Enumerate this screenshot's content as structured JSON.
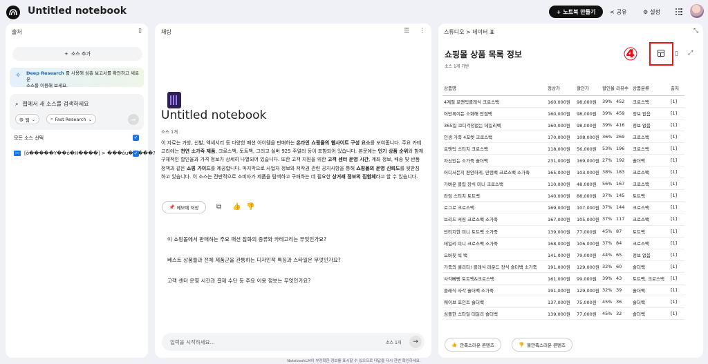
{
  "app": {
    "title": "Untitled notebook",
    "new_notebook": "노트북 만들기",
    "share": "공유",
    "settings": "설정"
  },
  "sources": {
    "title": "출처",
    "add_source": "소스 추가",
    "deep_research_strong": "Deep Research",
    "deep_research_text_1": "를 사용해 심층 보고서를 확인하고 새로운",
    "deep_research_text_2": "소스를 이용해 보세요.",
    "search_placeholder": "웹에서 새 소스를 검색하세요",
    "chip_web": "웹",
    "chip_research": "Fast Research",
    "select_all": "모든 소스 선택",
    "items": [
      {
        "name": "[ǒ�����Y��ǒ�H����] > ���ǒu�����?"
      }
    ]
  },
  "chat": {
    "title": "채팅",
    "notebook_title": "Untitled notebook",
    "source_count": "소스 1개",
    "save_memo": "메모에 저장",
    "questions": [
      "이 쇼핑몰에서 판매하는 주요 패션 잡화의 종류와 카테고리는 무엇인가요?",
      "베스트 상품들과 전체 제품군을 관통하는 디자인적 특징과 스타일은 무엇인가요?",
      "고객 센터 운영 시간과 결제 수단 등 주요 이용 정보는 무엇인가요?"
    ],
    "input_placeholder": "입력을 시작하세요...",
    "input_count": "소스 1개",
    "footer": "NotebookLM이 부정확한 정보를 표시할 수 있으므로 대답을 다시 한번 확인하세요."
  },
  "studio": {
    "breadcrumb": "스튜디오 > 데이터 표",
    "title": "쇼핑몰 상품 목록 정보",
    "subtitle": "소스 1개 기반",
    "badge": "④",
    "headers": [
      "상품명",
      "정상가",
      "할인가",
      "할인율",
      "리뷰수",
      "상품분류",
      "출처"
    ],
    "rows": [
      [
        "4계절 로맨틱클래식 크로스백",
        "160,000원",
        "98,000원",
        "39%",
        "452",
        "크로스백",
        "[1]"
      ],
      [
        "어반록이든 소화해 만점백",
        "160,000원",
        "98,000원",
        "39%",
        "459",
        "정보 없음",
        "[1]"
      ],
      [
        "365일 코디걱정없는 데일리백",
        "160,000원",
        "98,000원",
        "39%",
        "416",
        "정보 없음",
        "[1]"
      ],
      [
        "인생 가죽 4포켓 크로스백",
        "170,000원",
        "108,000원",
        "36%",
        "269",
        "크로스백",
        "[1]"
      ],
      [
        "로맨틱 스티치 크로스백",
        "118,000원",
        "56,000원",
        "53%",
        "196",
        "크로스백",
        "[1]"
      ],
      [
        "자신있는 소가죽 숄더백",
        "231,000원",
        "169,000원",
        "27%",
        "192",
        "숄더백",
        "[1]"
      ],
      [
        "어디서든지 편안하게, 만점백 크로스백 소가죽",
        "165,000원",
        "103,000원",
        "38%",
        "183",
        "크로스백",
        "[1]"
      ],
      [
        "가벼운 클립 장식 미니 크로스백",
        "110,000원",
        "48,000원",
        "56%",
        "167",
        "크로스백",
        "[1]"
      ],
      [
        "라임 스티치 토트백",
        "140,000원",
        "88,000원",
        "37%",
        "145",
        "토트백",
        "[1]"
      ],
      [
        "로그로 크로스백",
        "169,000원",
        "107,000원",
        "37%",
        "144",
        "크로스백",
        "[1]"
      ],
      [
        "브리드 셔링 크로스백 소가죽",
        "167,000원",
        "105,000원",
        "37%",
        "117",
        "크로스백",
        "[1]"
      ],
      [
        "빈티지한 미니 토트백 소가죽",
        "139,000원",
        "77,000원",
        "45%",
        "87",
        "토트백",
        "[1]"
      ],
      [
        "데일리 미니 크로스백 소가죽",
        "168,000원",
        "106,000원",
        "37%",
        "84",
        "크로스백",
        "[1]"
      ],
      [
        "오버핏 빅 백",
        "141,000원",
        "79,000원",
        "44%",
        "65",
        "정보 없음",
        "[1]"
      ],
      [
        "가죽의 퀄리티! 클래식 라운드 장식 숄더백 소가죽",
        "191,000원",
        "129,000원",
        "32%",
        "60",
        "숄더백",
        "[1]"
      ],
      [
        "사각빠빵 토트백&크로스백",
        "161,000원",
        "99,000원",
        "39%",
        "43",
        "토트백, 크로스백",
        "[1]"
      ],
      [
        "클래식 사각 숄더백 소가죽",
        "191,000원",
        "129,000원",
        "32%",
        "39",
        "숄더백",
        "[1]"
      ],
      [
        "웨이브 포인트 숄더백",
        "137,000원",
        "75,000원",
        "45%",
        "36",
        "숄더백",
        "[1]"
      ],
      [
        "심플한 스타일 데일리 숄더백",
        "139,000원",
        "77,000원",
        "45%",
        "32",
        "숄더백",
        "[1]"
      ]
    ],
    "feedback_good": "만족스러운 콘텐츠",
    "feedback_bad": "불만족스러운 콘텐츠"
  }
}
